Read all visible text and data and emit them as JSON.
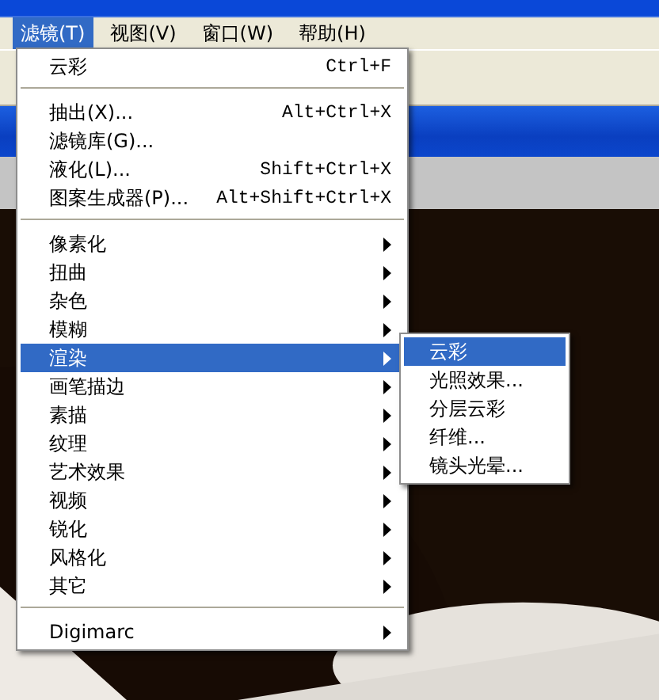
{
  "menu_bar": [
    {
      "label": "滤镜(T)",
      "selected": true
    },
    {
      "label": "视图(V)",
      "selected": false
    },
    {
      "label": "窗口(W)",
      "selected": false
    },
    {
      "label": "帮助(H)",
      "selected": false
    }
  ],
  "filter_menu": {
    "groups": [
      [
        {
          "kind": "command",
          "label": "云彩",
          "shortcut": "Ctrl+F",
          "selected": false
        }
      ],
      [
        {
          "kind": "command",
          "label": "抽出(X)...",
          "shortcut": "Alt+Ctrl+X",
          "selected": false
        },
        {
          "kind": "command",
          "label": "滤镜库(G)...",
          "selected": false
        },
        {
          "kind": "command",
          "label": "液化(L)...",
          "shortcut": "Shift+Ctrl+X",
          "selected": false
        },
        {
          "kind": "command",
          "label": "图案生成器(P)...",
          "shortcut": "Alt+Shift+Ctrl+X",
          "selected": false
        }
      ],
      [
        {
          "kind": "submenu",
          "label": "像素化",
          "selected": false
        },
        {
          "kind": "submenu",
          "label": "扭曲",
          "selected": false
        },
        {
          "kind": "submenu",
          "label": "杂色",
          "selected": false
        },
        {
          "kind": "submenu",
          "label": "模糊",
          "selected": false
        },
        {
          "kind": "submenu",
          "label": "渲染",
          "selected": true
        },
        {
          "kind": "submenu",
          "label": "画笔描边",
          "selected": false
        },
        {
          "kind": "submenu",
          "label": "素描",
          "selected": false
        },
        {
          "kind": "submenu",
          "label": "纹理",
          "selected": false
        },
        {
          "kind": "submenu",
          "label": "艺术效果",
          "selected": false
        },
        {
          "kind": "submenu",
          "label": "视频",
          "selected": false
        },
        {
          "kind": "submenu",
          "label": "锐化",
          "selected": false
        },
        {
          "kind": "submenu",
          "label": "风格化",
          "selected": false
        },
        {
          "kind": "submenu",
          "label": "其它",
          "selected": false
        }
      ],
      [
        {
          "kind": "submenu",
          "label": "Digimarc",
          "selected": false
        }
      ]
    ]
  },
  "render_submenu": [
    {
      "label": "云彩",
      "selected": true
    },
    {
      "label": "光照效果...",
      "selected": false
    },
    {
      "label": "分层云彩",
      "selected": false
    },
    {
      "label": "纤维...",
      "selected": false
    },
    {
      "label": "镜头光晕...",
      "selected": false
    }
  ]
}
